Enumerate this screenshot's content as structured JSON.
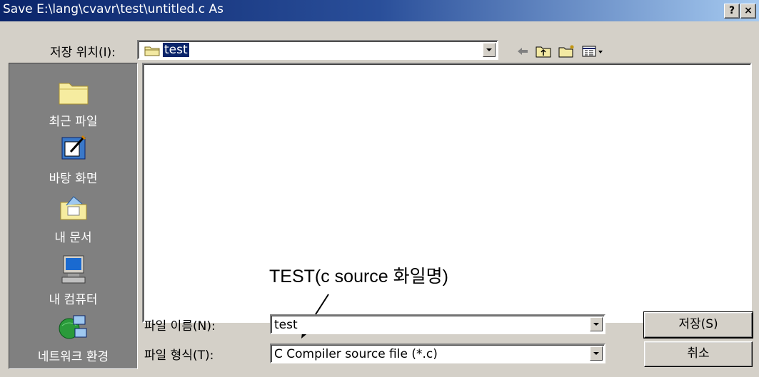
{
  "window": {
    "title": "Save E:\\lang\\cvavr\\test\\untitled.c As",
    "help_button": "?",
    "close_button": "×"
  },
  "location": {
    "label": "저장 위치(I):",
    "value": "test"
  },
  "places": [
    {
      "label": "최근 파일",
      "icon": "folder-icon"
    },
    {
      "label": "바탕 화면",
      "icon": "desktop-icon"
    },
    {
      "label": "내 문서",
      "icon": "my-documents-icon"
    },
    {
      "label": "내 컴퓨터",
      "icon": "my-computer-icon"
    },
    {
      "label": "네트워크 환경",
      "icon": "network-icon"
    }
  ],
  "filename": {
    "label": "파일 이름(N):",
    "value": "test"
  },
  "filetype": {
    "label": "파일 형식(T):",
    "value": "C Compiler source file (*.c)"
  },
  "buttons": {
    "save": "저장(S)",
    "cancel": "취소"
  },
  "annotation": {
    "text": "TEST(c source 화일명)"
  }
}
